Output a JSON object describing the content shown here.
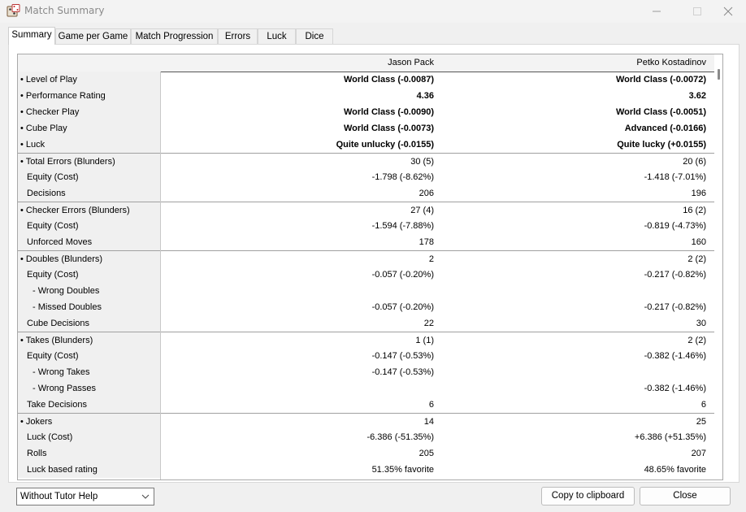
{
  "window": {
    "title": "Match Summary"
  },
  "tabs": [
    {
      "label": "Summary",
      "active": true
    },
    {
      "label": "Game per Game",
      "active": false
    },
    {
      "label": "Match Progression",
      "active": false
    },
    {
      "label": "Errors",
      "active": false
    },
    {
      "label": "Luck",
      "active": false
    },
    {
      "label": "Dice",
      "active": false
    }
  ],
  "table": {
    "headers": {
      "player1": "Jason Pack",
      "player2": "Petko Kostadinov"
    },
    "rows": [
      {
        "label": "• Level of Play",
        "p1": "World Class (-0.0087)",
        "p2": "World Class (-0.0072)"
      },
      {
        "label": "• Performance Rating",
        "p1": "4.36",
        "p2": "3.62"
      },
      {
        "label": "• Checker Play",
        "p1": "World Class (-0.0090)",
        "p2": "World Class (-0.0051)"
      },
      {
        "label": "• Cube Play",
        "p1": "World Class (-0.0073)",
        "p2": "Advanced (-0.0166)"
      },
      {
        "label": "• Luck",
        "p1": "Quite unlucky (-0.0155)",
        "p2": "Quite lucky (+0.0155)"
      },
      {
        "label": "• Total Errors (Blunders)",
        "p1": "30 (5)",
        "p2": "20 (6)"
      },
      {
        "label": "Equity (Cost)",
        "p1": "-1.798 (-8.62%)",
        "p2": "-1.418 (-7.01%)"
      },
      {
        "label": "Decisions",
        "p1": "206",
        "p2": "196"
      },
      {
        "label": "• Checker Errors (Blunders)",
        "p1": "27 (4)",
        "p2": "16 (2)"
      },
      {
        "label": "Equity (Cost)",
        "p1": "-1.594 (-7.88%)",
        "p2": "-0.819 (-4.73%)"
      },
      {
        "label": "Unforced Moves",
        "p1": "178",
        "p2": "160"
      },
      {
        "label": "• Doubles (Blunders)",
        "p1": "2",
        "p2": "2 (2)"
      },
      {
        "label": "Equity (Cost)",
        "p1": "-0.057 (-0.20%)",
        "p2": "-0.217 (-0.82%)"
      },
      {
        "label": "- Wrong Doubles",
        "p1": "",
        "p2": ""
      },
      {
        "label": "- Missed Doubles",
        "p1": "-0.057 (-0.20%)",
        "p2": "-0.217 (-0.82%)"
      },
      {
        "label": "Cube Decisions",
        "p1": "22",
        "p2": "30"
      },
      {
        "label": "• Takes (Blunders)",
        "p1": "1 (1)",
        "p2": "2 (2)"
      },
      {
        "label": "Equity (Cost)",
        "p1": "-0.147 (-0.53%)",
        "p2": "-0.382 (-1.46%)"
      },
      {
        "label": "- Wrong Takes",
        "p1": "-0.147 (-0.53%)",
        "p2": ""
      },
      {
        "label": "- Wrong Passes",
        "p1": "",
        "p2": "-0.382 (-1.46%)"
      },
      {
        "label": "Take Decisions",
        "p1": "6",
        "p2": "6"
      },
      {
        "label": "• Jokers",
        "p1": "14",
        "p2": "25"
      },
      {
        "label": "Luck (Cost)",
        "p1": "-6.386 (-51.35%)",
        "p2": "+6.386 (+51.35%)"
      },
      {
        "label": "Rolls",
        "p1": "205",
        "p2": "207"
      },
      {
        "label": "Luck based rating",
        "p1": "51.35% favorite",
        "p2": "48.65% favorite"
      }
    ]
  },
  "footer": {
    "tutor_select": "Without Tutor Help",
    "copy_button": "Copy to clipboard",
    "close_button": "Close"
  },
  "icons": {
    "app": "backgammon-app-icon",
    "minimize": "minimize-icon",
    "maximize": "maximize-icon",
    "close": "close-icon",
    "dropdown": "chevron-down-icon"
  },
  "colors": {
    "title_text": "#8a8a8a",
    "panel_bg": "#ffffff",
    "label_bg": "#f0f0f0"
  }
}
